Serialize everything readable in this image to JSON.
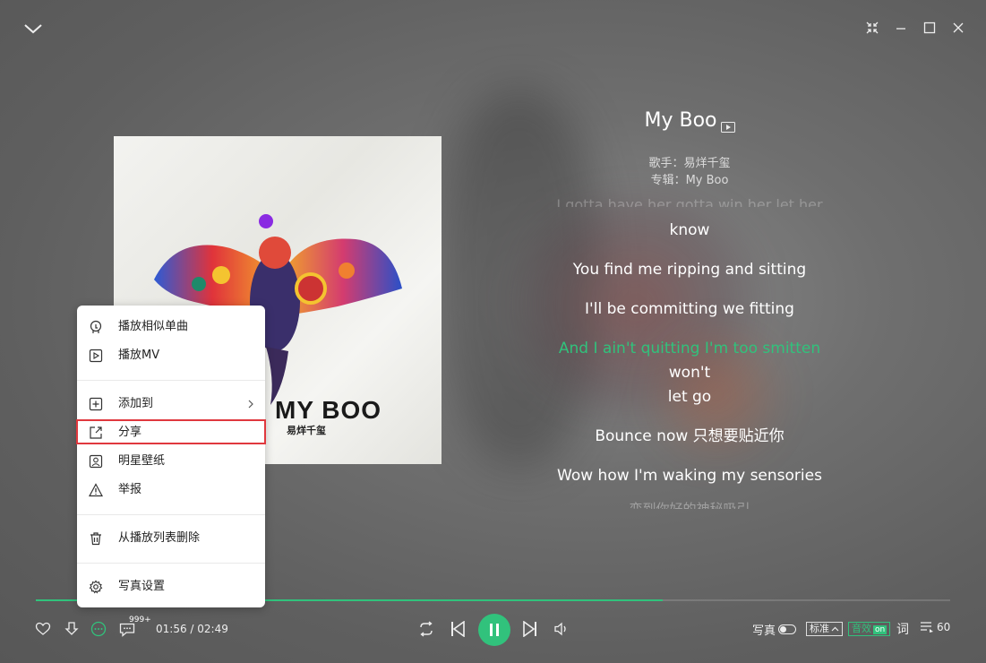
{
  "window": {
    "collapse_icon": "chevron-down-icon",
    "controls": [
      "shrink-icon",
      "minimize-icon",
      "maximize-icon",
      "close-icon"
    ]
  },
  "album": {
    "cover_title": "MY BOO",
    "cover_sub": "易烊千玺"
  },
  "song": {
    "title": "My Boo",
    "artist_line": "歌手：易烊千玺",
    "album_line": "专辑：My Boo"
  },
  "lyrics": {
    "prev_fragment": "I gotta have her gotta win her let her",
    "line1": "know",
    "line2": "You find me ripping and sitting",
    "line3": "I'll be committing we fitting",
    "current_sung": "And I ain't quitting I'm too smitten",
    "current_rest": " won't",
    "current_line2": "let go",
    "line5": "Bounce now 只想要贴近你",
    "line6": "Wow how I'm waking my sensories",
    "next_fragment": "变到你好的神秘吸引"
  },
  "context_menu": {
    "items": [
      {
        "label": "播放相似单曲",
        "icon": "similar-songs-icon"
      },
      {
        "label": "播放MV",
        "icon": "play-mv-icon"
      },
      {
        "label": "添加到",
        "icon": "add-to-icon"
      },
      {
        "label": "分享",
        "icon": "share-icon"
      },
      {
        "label": "明星壁纸",
        "icon": "wallpaper-icon"
      },
      {
        "label": "举报",
        "icon": "report-icon"
      },
      {
        "label": "从播放列表删除",
        "icon": "delete-icon"
      },
      {
        "label": "写真设置",
        "icon": "settings-icon"
      }
    ],
    "highlighted": "分享"
  },
  "player": {
    "current_time": "01:56",
    "total_time": "02:49",
    "time_text": "01:56 / 02:49",
    "progress_fraction": 0.686,
    "comment_badge": "999+",
    "photo_label": "写真",
    "quality_label": "标准",
    "sfx_label": "音效",
    "sfx_state": "on",
    "lyrics_label": "词",
    "playlist_count": "60"
  },
  "colors": {
    "accent": "#31c27c",
    "highlight_border": "#e0383e"
  }
}
